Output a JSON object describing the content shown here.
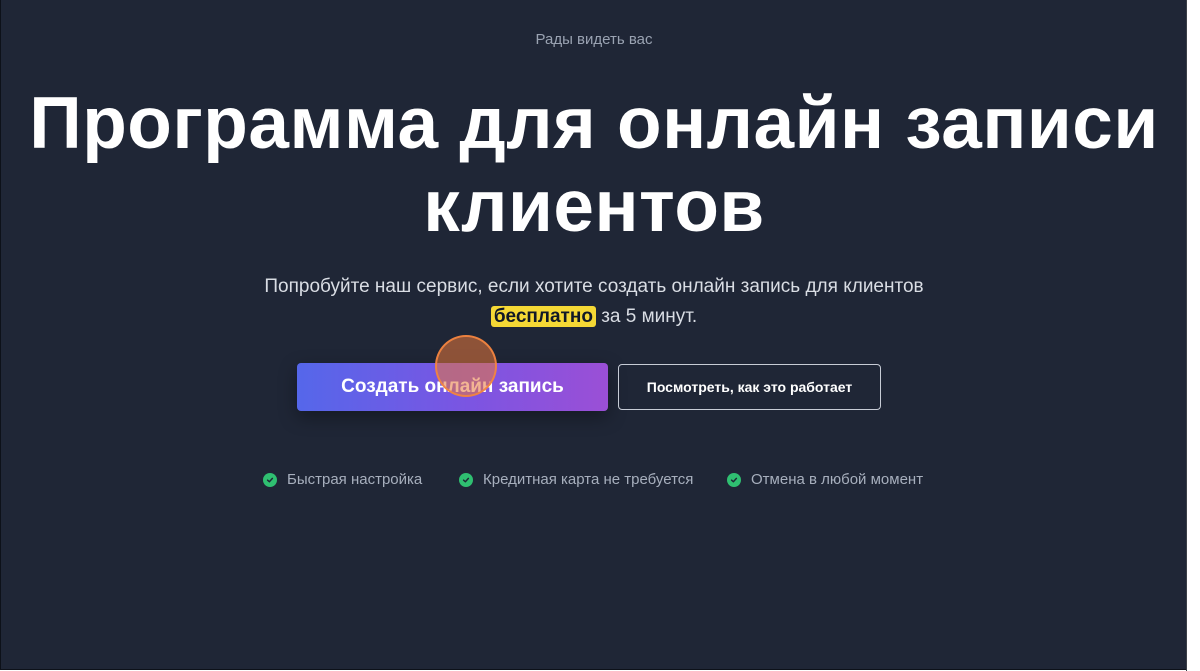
{
  "hero": {
    "eyebrow": "Рады видеть вас",
    "title": "Программа для онлайн записи клиентов",
    "subtitle_before": "Попробуйте наш сервис, если хотите создать онлайн запись для клиентов",
    "subtitle_highlight": "бесплатно",
    "subtitle_after": " за 5 минут."
  },
  "buttons": {
    "primary_label": "Создать онлайн запись",
    "secondary_label": "Посмотреть, как это работает"
  },
  "features": [
    {
      "label": "Быстрая настройка",
      "icon": "check-circle-icon"
    },
    {
      "label": "Кредитная карта не требуется",
      "icon": "check-circle-icon"
    },
    {
      "label": "Отмена в любой момент",
      "icon": "check-circle-icon"
    }
  ],
  "colors": {
    "background": "#1f2636",
    "highlight": "#f5d835",
    "check": "#2fbf71",
    "primary_gradient_start": "#5567ea",
    "primary_gradient_end": "#9b4fd6"
  }
}
